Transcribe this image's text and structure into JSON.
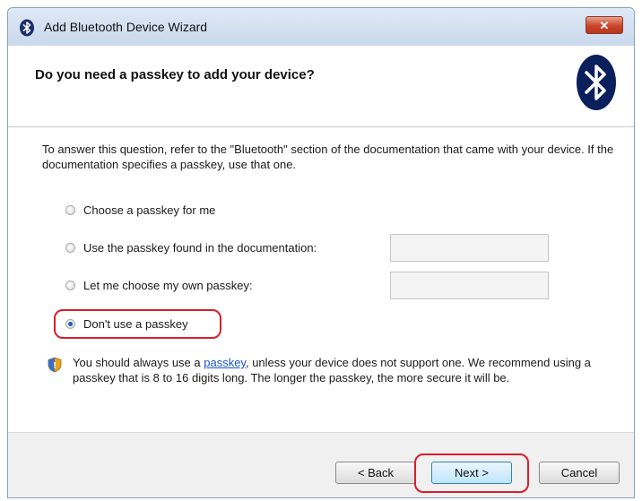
{
  "window": {
    "title": "Add Bluetooth Device Wizard",
    "close_label": "✕"
  },
  "header": {
    "title": "Do you need a passkey to add your device?",
    "logo_icon": "bluetooth-icon"
  },
  "content": {
    "intro": "To answer this question, refer to the \"Bluetooth\" section of the documentation that came with your device. If the documentation specifies a passkey, use that one.",
    "options": [
      {
        "label": "Choose a passkey for me",
        "checked": false
      },
      {
        "label": "Use the passkey found in the documentation:",
        "checked": false,
        "field_value": ""
      },
      {
        "label": "Let me choose my own passkey:",
        "checked": false,
        "field_value": ""
      },
      {
        "label": "Don't use a passkey",
        "checked": true
      }
    ],
    "note_before": "You should always use a ",
    "note_link": "passkey",
    "note_after": ", unless your device does not support one. We recommend using a passkey that is 8 to 16 digits long. The longer the passkey, the more secure it will be.",
    "note_icon": "shield-icon"
  },
  "footer": {
    "back_label": "< Back",
    "next_label": "Next >",
    "cancel_label": "Cancel"
  },
  "colors": {
    "highlight": "#d81e2c",
    "link": "#1a55c8",
    "radio_selected": "#1e5fb4"
  }
}
